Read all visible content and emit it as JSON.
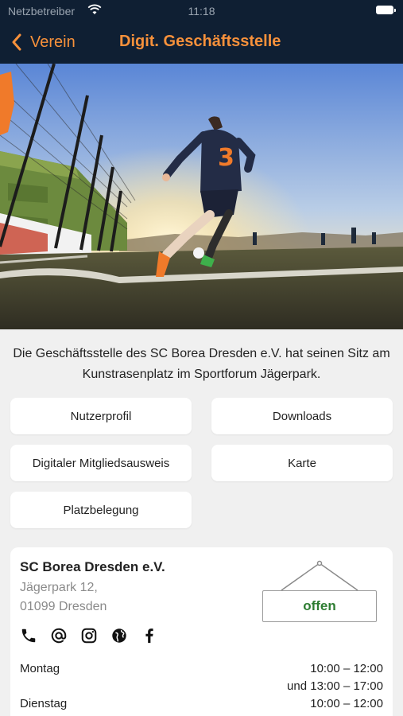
{
  "status_bar": {
    "carrier": "Netzbetreiber",
    "time": "11:18"
  },
  "nav": {
    "back_label": "Verein",
    "title": "Digit. Geschäftsstelle"
  },
  "colors": {
    "accent": "#f7913b",
    "header_bg": "#0f1f33",
    "open_green": "#2e7d32"
  },
  "intro": {
    "text": "Die Geschäftsstelle des SC Borea Dresden e.V. hat seinen Sitz am Kunstrasenplatz im Sportforum Jägerpark."
  },
  "tiles": [
    {
      "label": "Nutzerprofil"
    },
    {
      "label": "Downloads"
    },
    {
      "label": "Digitaler Mitgliedsausweis"
    },
    {
      "label": "Karte"
    },
    {
      "label": "Platzbelegung"
    }
  ],
  "contact": {
    "club_name": "SC Borea Dresden e.V.",
    "street": "Jägerpark 12,",
    "city": "01099 Dresden",
    "status": "offen",
    "icons": [
      "phone-icon",
      "email-icon",
      "instagram-icon",
      "globe-icon",
      "facebook-icon"
    ]
  },
  "hours": [
    {
      "day": "Montag",
      "time1": "10:00 – 12:00",
      "time2": "und 13:00 – 17:00"
    },
    {
      "day": "Dienstag",
      "time1": "10:00 – 12:00"
    }
  ]
}
